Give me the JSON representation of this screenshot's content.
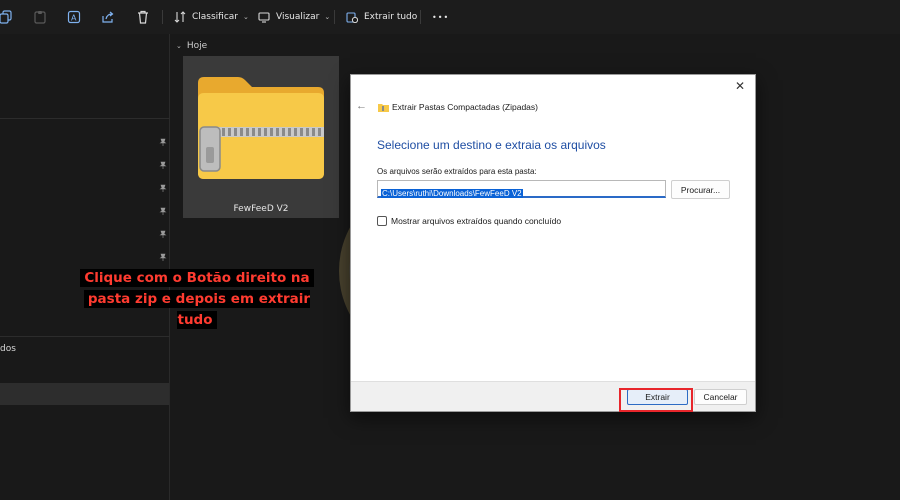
{
  "toolbar": {
    "sort_label": "Classificar",
    "view_label": "Visualizar",
    "extract_all_label": "Extrair tudo",
    "more_label": "•••"
  },
  "sidebar": {
    "partial_item_text": "dos"
  },
  "content": {
    "group_label": "Hoje",
    "file_name": "FewFeeD V2"
  },
  "annotation": {
    "line1": "Clique com o Botão direito na",
    "line2": "pasta zip e depois em extrair tudo"
  },
  "dialog": {
    "title": "Extrair Pastas Compactadas (Zipadas)",
    "close_glyph": "✕",
    "back_glyph": "←",
    "heading": "Selecione um destino e extraia os arquivos",
    "path_label": "Os arquivos serão extraídos para esta pasta:",
    "path_value": "C:\\Users\\ruthi\\Downloads\\FewFeeD V2",
    "browse_label": "Procurar...",
    "show_files_label": "Mostrar arquivos extraídos quando concluído",
    "show_files_checked": false,
    "extract_label": "Extrair",
    "cancel_label": "Cancelar"
  },
  "colors": {
    "background": "#191919",
    "annotation_text": "#ff3b30",
    "heading_blue": "#1f4ea3",
    "selection_blue": "#0a62d6",
    "highlight_red": "#e8262b",
    "folder_yellow": "#f7c948"
  }
}
